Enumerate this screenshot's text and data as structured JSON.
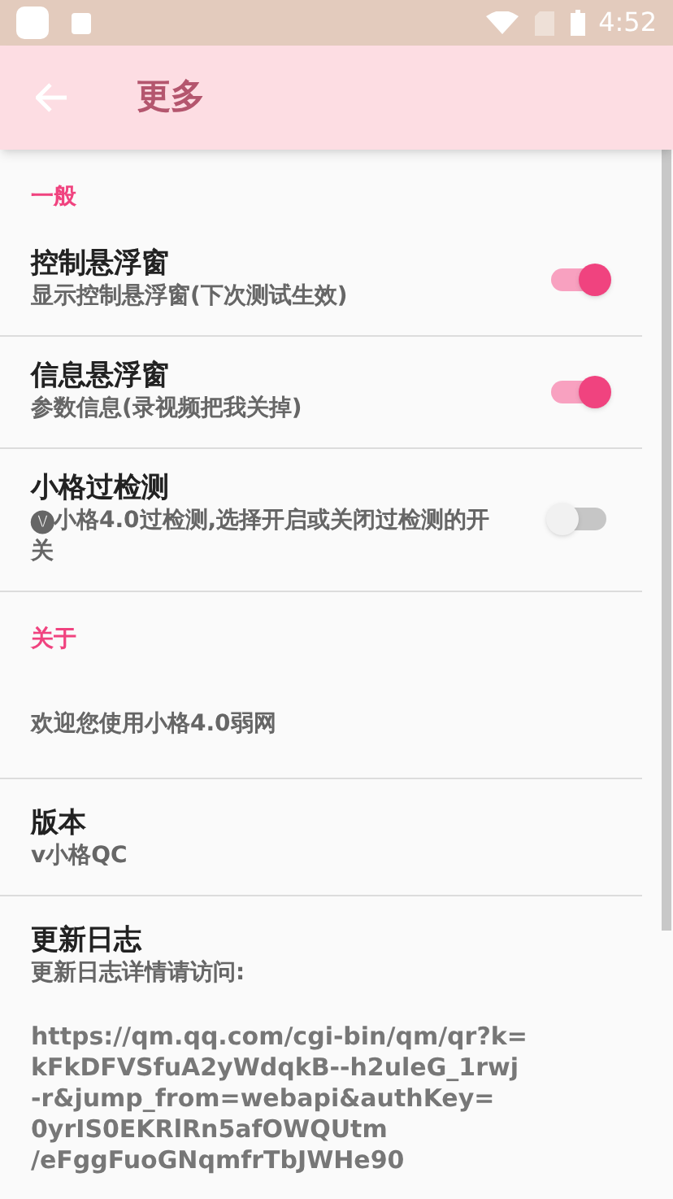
{
  "status_bar": {
    "time": "4:52"
  },
  "app_bar": {
    "title": "更多"
  },
  "sections": [
    {
      "kind": "header",
      "title": "一般"
    },
    {
      "kind": "switch",
      "title": "控制悬浮窗",
      "summary": "显示控制悬浮窗(下次测试生效)",
      "on": true
    },
    {
      "kind": "switch",
      "title": "信息悬浮窗",
      "summary": "参数信息(录视频把我关掉)",
      "on": true
    },
    {
      "kind": "switch",
      "title": "小格过检测",
      "summary": "🅥小格4.0过检测,选择开启或关闭过检测的开关",
      "on": false
    },
    {
      "kind": "header",
      "title": "关于"
    },
    {
      "kind": "text",
      "summary": "欢迎您使用小格4.0弱网"
    },
    {
      "kind": "info",
      "title": "版本",
      "summary": "v小格QC"
    },
    {
      "kind": "info",
      "title": "更新日志",
      "summary": "更新日志详情请访问:",
      "lines": [
        "https://qm.qq.com/cgi-bin/qm/qr?k=",
        "kFkDFVSfuA2yWdqkB--h2uleG_1rwj",
        "-r&jump_from=webapi&authKey=",
        "0yrIS0EKRlRn5afOWQUtm",
        "/eFggFuoGNqmfrTbJWHe90"
      ]
    }
  ]
}
